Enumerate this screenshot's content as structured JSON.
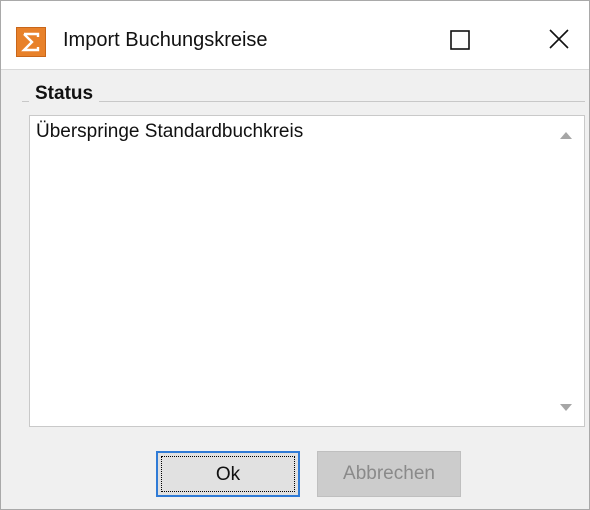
{
  "window": {
    "title": "Import Buchungskreise",
    "icon": "sigma-icon"
  },
  "titlebar_buttons": {
    "maximize_icon": "maximize-icon",
    "close_icon": "close-icon"
  },
  "status_group": {
    "label": "Status",
    "lines": [
      "Überspringe Standardbuchkreis"
    ]
  },
  "buttons": {
    "ok_label": "Ok",
    "cancel_label": "Abbrechen"
  },
  "colors": {
    "app_icon": "#e8812a",
    "focus_border": "#2f7bd6"
  }
}
